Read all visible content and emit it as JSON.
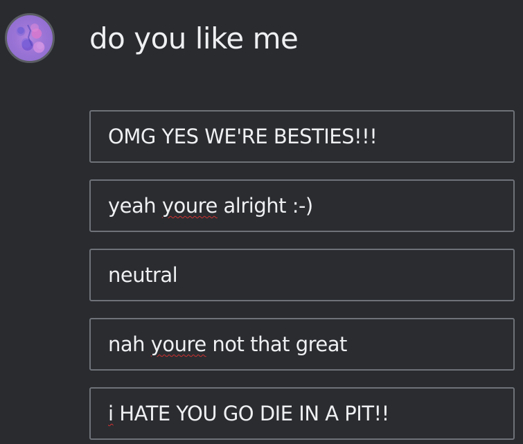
{
  "poll": {
    "question": "do you like me",
    "avatar_icon": "user-avatar",
    "options": [
      {
        "label": "OMG YES WE'RE BESTIES!!!"
      },
      {
        "label_before": "yeah ",
        "label_misspelled": "youre",
        "label_after": " alright :-)"
      },
      {
        "label": "neutral"
      },
      {
        "label_before": "nah ",
        "label_misspelled": "youre",
        "label_after": " not that great"
      },
      {
        "label_before": "",
        "label_misspelled": "i",
        "label_after": " HATE YOU GO DIE IN A PIT!!"
      }
    ]
  },
  "colors": {
    "background": "#292b2f",
    "text": "#eef0f2",
    "option_border": "#6f7379",
    "spellcheck": "#d13131"
  }
}
